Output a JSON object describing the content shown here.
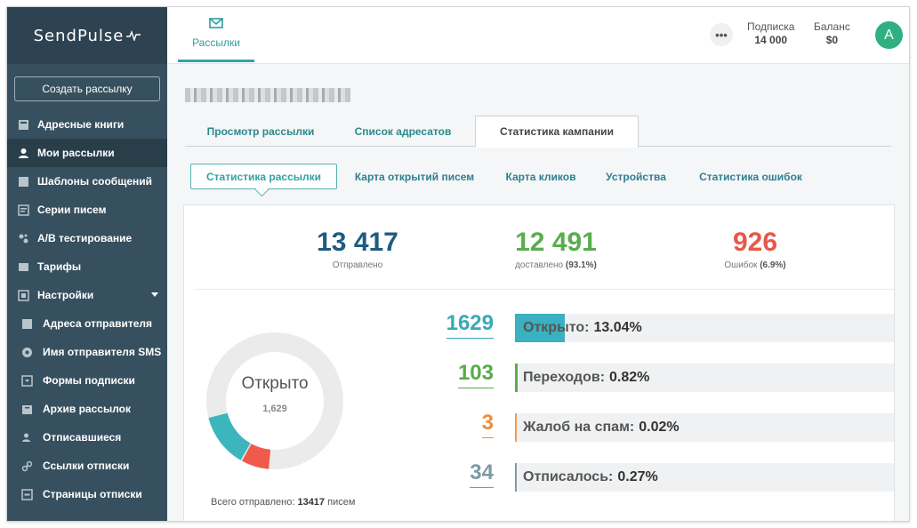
{
  "sidebar": {
    "logo": "SendPulse",
    "create_button": "Создать рассылку",
    "items": [
      {
        "label": "Адресные книги"
      },
      {
        "label": "Мои рассылки"
      },
      {
        "label": "Шаблоны сообщений"
      },
      {
        "label": "Серии писем"
      },
      {
        "label": "A/B тестирование"
      },
      {
        "label": "Тарифы"
      },
      {
        "label": "Настройки"
      },
      {
        "label": "Адреса отправителя"
      },
      {
        "label": "Имя отправителя SMS"
      },
      {
        "label": "Формы подписки"
      },
      {
        "label": "Архив рассылок"
      },
      {
        "label": "Отписавшиеся"
      },
      {
        "label": "Ссылки отписки"
      },
      {
        "label": "Страницы отписки"
      }
    ]
  },
  "header": {
    "tab_label": "Рассылки",
    "more": "•••",
    "subscription_label": "Подписка",
    "subscription_value": "14 000",
    "balance_label": "Баланс",
    "balance_value": "$0",
    "avatar_letter": "A"
  },
  "tabs": [
    "Просмотр рассылки",
    "Список адресатов",
    "Статистика кампании"
  ],
  "subtabs": [
    "Статистика рассылки",
    "Карта открытий писем",
    "Карта кликов",
    "Устройства",
    "Статистика ошибок"
  ],
  "summary": {
    "sent_value": "13 417",
    "sent_label": "Отправлено",
    "delivered_value": "12 491",
    "delivered_label": "доставлено",
    "delivered_pct": "(93.1%)",
    "errors_value": "926",
    "errors_label": "Ошибок",
    "errors_pct": "(6.9%)"
  },
  "donut": {
    "label": "Открыто",
    "value": "1,629",
    "total_prefix": "Всего отправлено:",
    "total_value": "13417",
    "total_suffix": "писем",
    "segments": [
      {
        "fraction": 0.1304,
        "color": "#3db5bd"
      },
      {
        "fraction": 0.069,
        "color": "#ef5a4b"
      }
    ]
  },
  "metrics": [
    {
      "count": "1629",
      "label": "Открыто:",
      "value": "13.04%",
      "fraction": 0.1304,
      "color": "#3ab0c0",
      "num_color": "#39a9b6"
    },
    {
      "count": "103",
      "label": "Переходов:",
      "value": "0.82%",
      "fraction": 0.0082,
      "color": "#5aad4e",
      "num_color": "#59ab4b"
    },
    {
      "count": "3",
      "label": "Жалоб на спам:",
      "value": "0.02%",
      "fraction": 0.0002,
      "color": "#f09c53",
      "num_color": "#ef8d3c"
    },
    {
      "count": "34",
      "label": "Отписалось:",
      "value": "0.27%",
      "fraction": 0.0027,
      "color": "#7d9aa3",
      "num_color": "#7d9aa3"
    }
  ],
  "colors": {
    "sent": "#1f5c7e",
    "delivered": "#5aad4e",
    "errors": "#e85749",
    "accent": "#36a3a6"
  }
}
